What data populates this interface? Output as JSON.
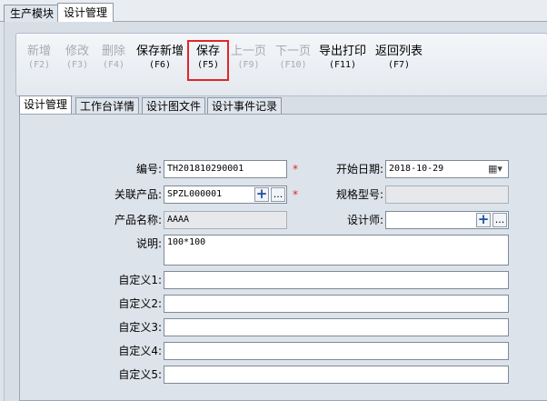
{
  "module_tabs": [
    {
      "label": "生产模块"
    },
    {
      "label": "设计管理"
    }
  ],
  "toolbar": [
    {
      "label": "新增",
      "key": "(F2)",
      "state": "disabled"
    },
    {
      "label": "修改",
      "key": "(F3)",
      "state": "disabled"
    },
    {
      "label": "删除",
      "key": "(F4)",
      "state": "disabled"
    },
    {
      "label": "保存新增",
      "key": "(F6)",
      "state": "enabled"
    },
    {
      "label": "保存",
      "key": "(F5)",
      "state": "highlighted"
    },
    {
      "label": "上一页",
      "key": "(F9)",
      "state": "disabled"
    },
    {
      "label": "下一页",
      "key": "(F10)",
      "state": "disabled"
    },
    {
      "label": "导出打印",
      "key": "(F11)",
      "state": "enabled"
    },
    {
      "label": "返回列表",
      "key": "(F7)",
      "state": "enabled"
    }
  ],
  "sub_tabs": [
    {
      "label": "设计管理"
    },
    {
      "label": "工作台详情"
    },
    {
      "label": "设计图文件"
    },
    {
      "label": "设计事件记录"
    }
  ],
  "form": {
    "code_label": "编号:",
    "code_value": "TH201810290001",
    "start_date_label": "开始日期:",
    "start_date_value": "2018-10-29",
    "product_label": "关联产品:",
    "product_value": "SPZL000001",
    "spec_label": "规格型号:",
    "spec_value": "",
    "product_name_label": "产品名称:",
    "product_name_value": "AAAA",
    "designer_label": "设计师:",
    "designer_value": "",
    "desc_label": "说明:",
    "desc_value": "100*100",
    "custom1_label": "自定义1:",
    "custom2_label": "自定义2:",
    "custom3_label": "自定义3:",
    "custom4_label": "自定义4:",
    "custom5_label": "自定义5:",
    "required_mark": "*",
    "plus_glyph": "+",
    "more_glyph": "...",
    "calendar_glyph": "▦▾"
  },
  "colors": {
    "highlight_border": "#e0262a",
    "required": "#e0262a",
    "disabled_text": "#a7abb0",
    "plus_icon": "#1d4f9a"
  }
}
